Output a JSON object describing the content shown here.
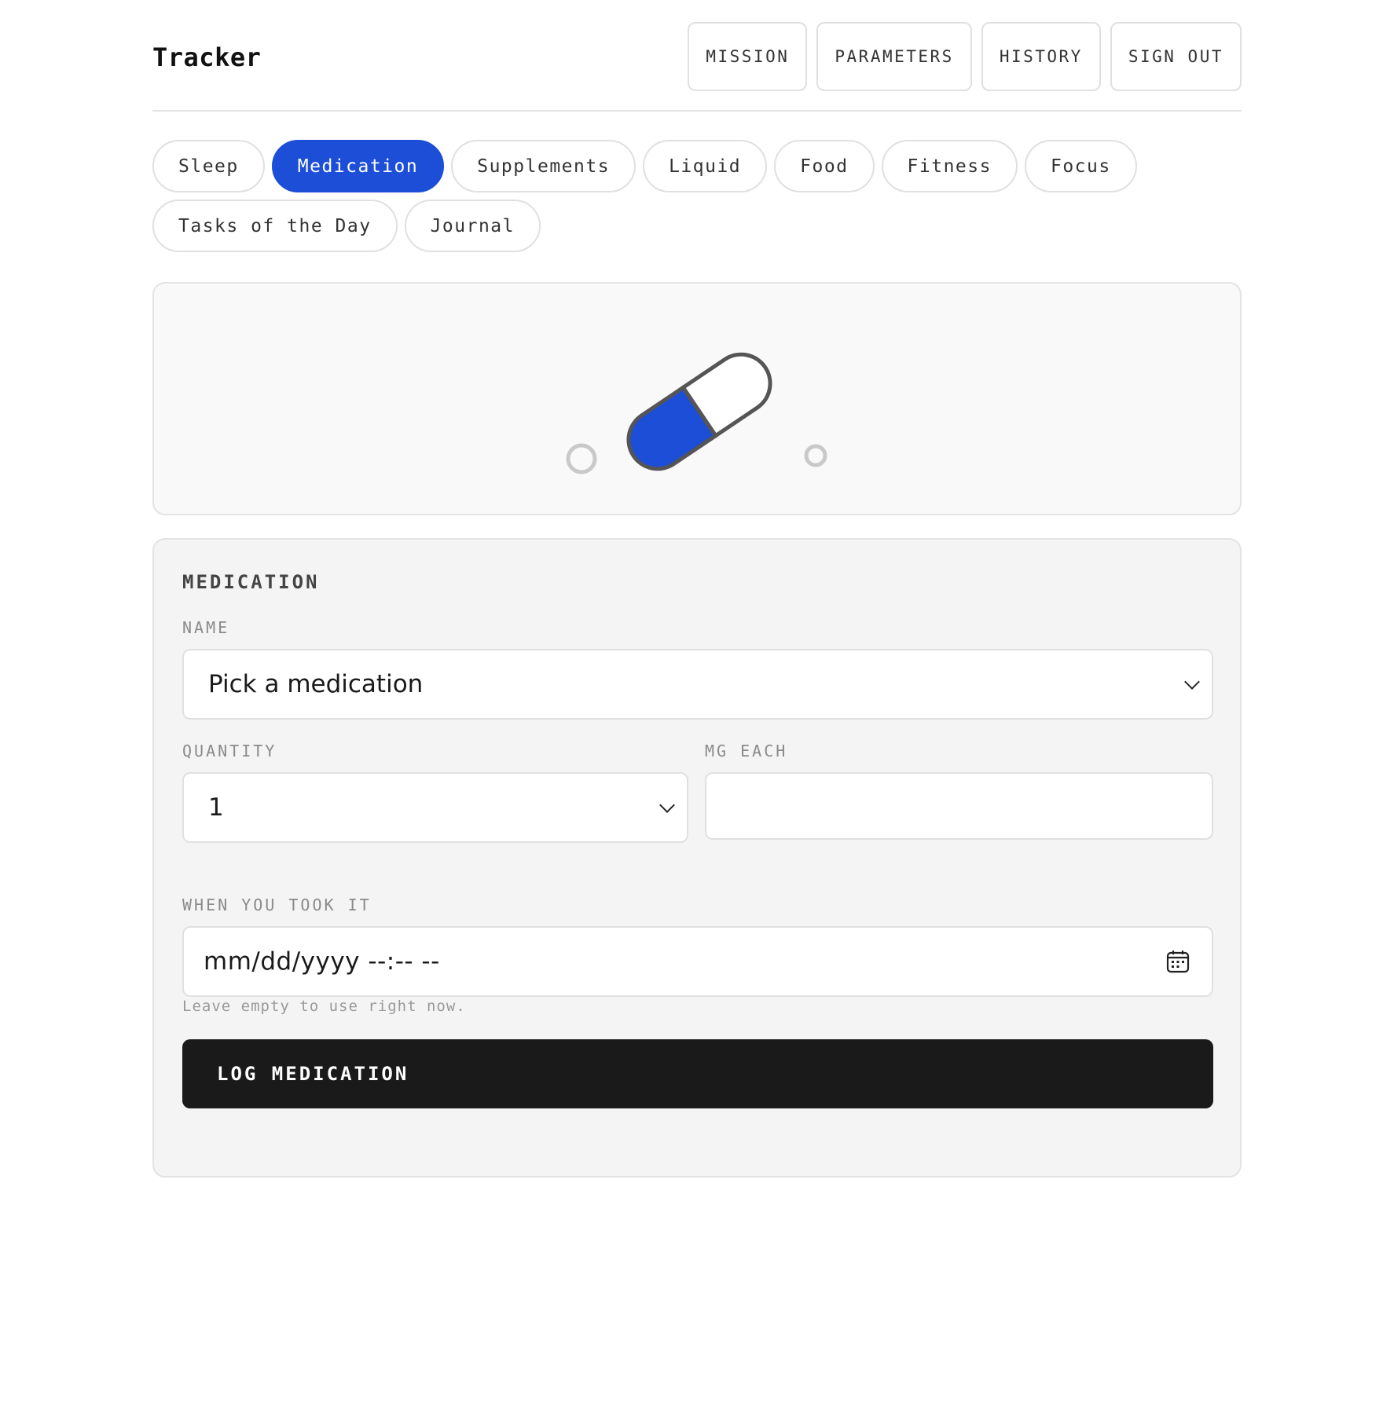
{
  "app": {
    "title": "Tracker"
  },
  "nav": [
    {
      "label": "MISSION"
    },
    {
      "label": "PARAMETERS"
    },
    {
      "label": "HISTORY"
    },
    {
      "label": "SIGN OUT"
    }
  ],
  "tabs": [
    {
      "label": "Sleep",
      "active": false
    },
    {
      "label": "Medication",
      "active": true
    },
    {
      "label": "Supplements",
      "active": false
    },
    {
      "label": "Liquid",
      "active": false
    },
    {
      "label": "Food",
      "active": false
    },
    {
      "label": "Fitness",
      "active": false
    },
    {
      "label": "Focus",
      "active": false
    },
    {
      "label": "Tasks of the Day",
      "active": false
    },
    {
      "label": "Journal",
      "active": false
    }
  ],
  "hero": {
    "icon": "pill-icon",
    "accent": "#1d4ed8"
  },
  "form": {
    "title": "MEDICATION",
    "name": {
      "label": "NAME",
      "value": "Pick a medication"
    },
    "quantity": {
      "label": "QUANTITY",
      "value": "1"
    },
    "mg_each": {
      "label": "MG EACH",
      "value": ""
    },
    "when": {
      "label": "WHEN YOU TOOK IT",
      "placeholder": "mm/dd/yyyy --:-- --"
    },
    "hint": "Leave empty to use right now.",
    "submit_label": "LOG MEDICATION"
  },
  "colors": {
    "accent": "#1d4ed8",
    "button_dark": "#1a1a1a",
    "panel_bg": "#f4f4f4"
  }
}
